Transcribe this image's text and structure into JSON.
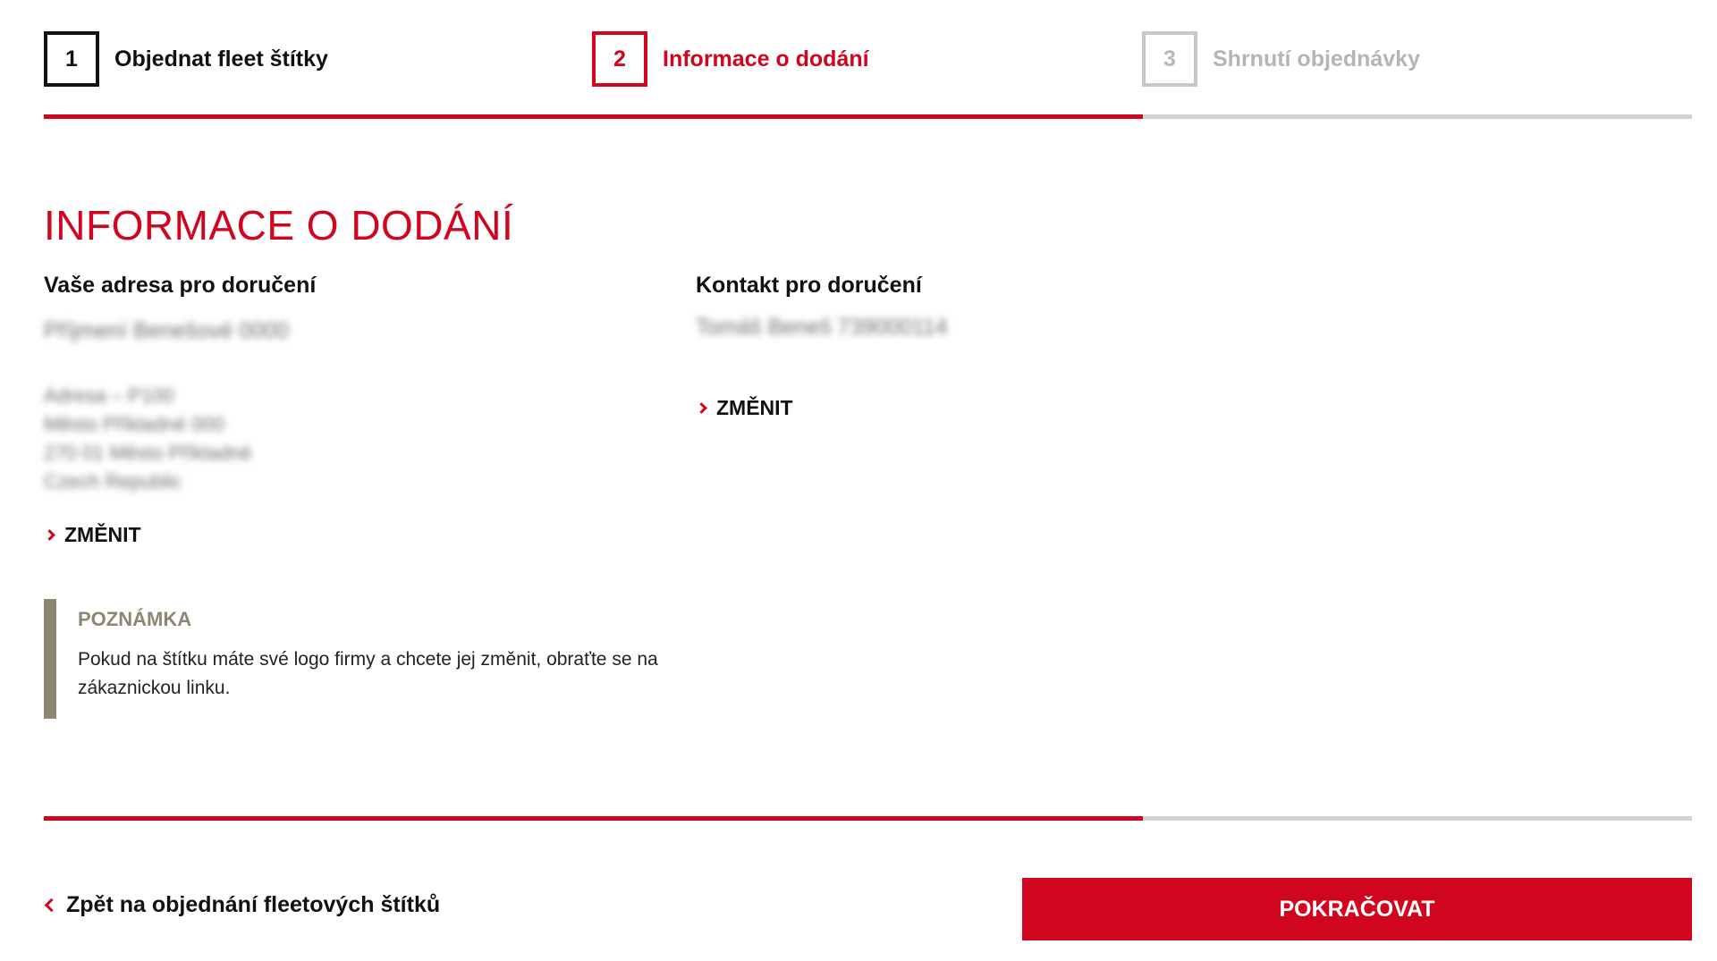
{
  "stepper": {
    "steps": [
      {
        "number": "1",
        "label": "Objednat fleet štítky",
        "state": "done"
      },
      {
        "number": "2",
        "label": "Informace o dodání",
        "state": "active"
      },
      {
        "number": "3",
        "label": "Shrnutí objednávky",
        "state": "todo"
      }
    ],
    "progress_percent": 66.7
  },
  "page": {
    "title": "INFORMACE O DODÁNÍ"
  },
  "address": {
    "heading": "Vaše adresa pro doručení",
    "name": "Příjmení Benešové 0000",
    "lines": [
      "Adresa – P100",
      "Město Příkladné 000",
      "270 01 Město Příkladné",
      "Czech Republic"
    ],
    "change_label": "ZMĚNIT"
  },
  "contact": {
    "heading": "Kontakt pro doručení",
    "line": "Tomáš Beneš 739000114",
    "change_label": "ZMĚNIT"
  },
  "note": {
    "title": "POZNÁMKA",
    "text": "Pokud na štítku máte své logo firmy a chcete jej změnit, obraťte se na zákaznickou linku."
  },
  "footer": {
    "back_label": "Zpět na objednání fleetových štítků",
    "continue_label": "POKRAČOVAT"
  },
  "colors": {
    "accent": "#d0051f",
    "note_bar": "#8e8673",
    "inactive": "#c8c8c8"
  }
}
